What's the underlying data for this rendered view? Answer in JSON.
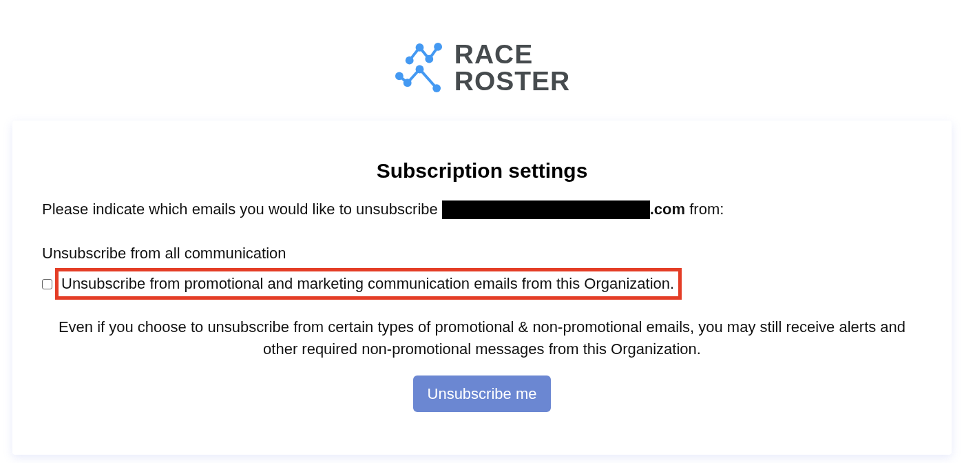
{
  "logo": {
    "line_1": "RACE",
    "line_2": "ROSTER"
  },
  "card": {
    "title": "Subscription settings",
    "intro": {
      "before": "Please indicate which emails you would like to unsubscribe",
      "redacted": true,
      "after": "**.com** from:"
    },
    "section_label": "Unsubscribe from all communication",
    "options": [
      {
        "label": "Unsubscribe from promotional and marketing communication emails from this Organization.",
        "checked": false,
        "highlighted": true
      }
    ],
    "notice": "Even if you choose to unsubscribe from certain types of promotional & non-promotional emails, you may still receive alerts and other required non-promotional messages from this Organization.",
    "submit_button": "Unsubscribe me"
  }
}
